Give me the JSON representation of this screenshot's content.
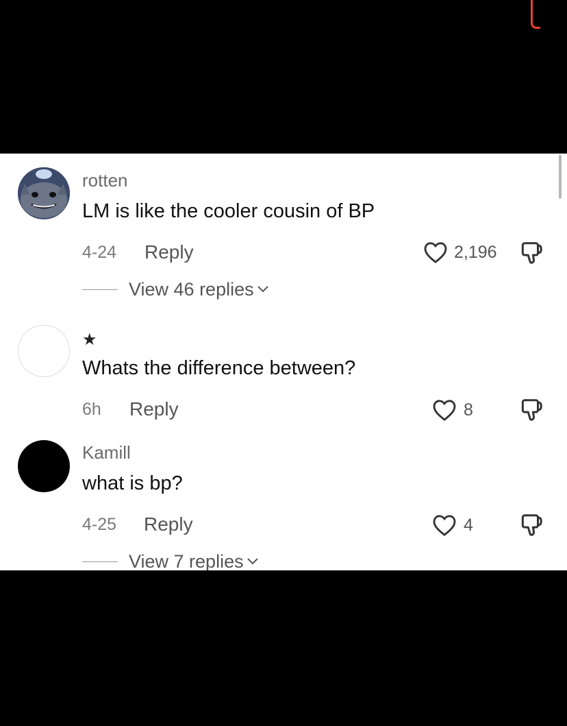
{
  "comments": [
    {
      "username": "rotten",
      "avatar": "cat-avatar",
      "text": "LM is like the cooler cousin of BP",
      "date": "4-24",
      "reply_label": "Reply",
      "likes": "2,196",
      "view_replies": "View 46 replies"
    },
    {
      "username": "",
      "badge": "★",
      "avatar": "blank-avatar",
      "text": "Whats the difference between?",
      "date": "6h",
      "reply_label": "Reply",
      "likes": "8"
    },
    {
      "username": "Kamill",
      "avatar": "black-avatar",
      "text": "what is bp?",
      "date": "4-25",
      "reply_label": "Reply",
      "likes": "4",
      "view_replies": "View 7 replies"
    }
  ],
  "icons": {
    "like": "heart-outline-icon",
    "dislike": "thumbs-down-icon",
    "expand": "chevron-down-icon"
  },
  "colors": {
    "background": "#ffffff",
    "secondary_text": "#6b6b6b",
    "accent_mark": "#e8412c"
  }
}
